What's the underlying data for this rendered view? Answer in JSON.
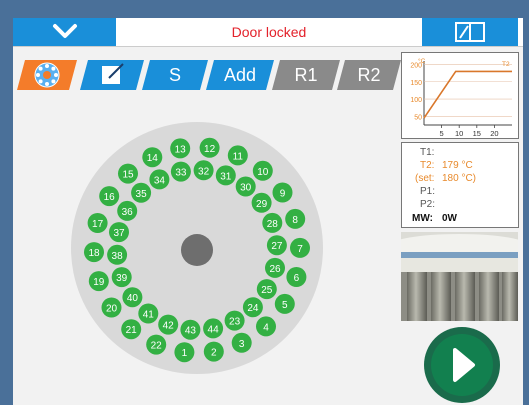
{
  "header": {
    "door_status": "Door locked"
  },
  "tabs": [
    {
      "label": "",
      "icon": "carousel-icon",
      "active": true
    },
    {
      "label": "",
      "icon": "edit-icon",
      "active": false
    },
    {
      "label": "S",
      "active": false
    },
    {
      "label": "Add",
      "active": false
    },
    {
      "label": "R1",
      "active": false
    },
    {
      "label": "R2",
      "active": false
    }
  ],
  "carousel": {
    "positions": [
      "1",
      "2",
      "3",
      "4",
      "5",
      "6",
      "7",
      "8",
      "9",
      "10",
      "11",
      "12",
      "13",
      "14",
      "15",
      "16",
      "17",
      "18",
      "19",
      "20",
      "21",
      "22",
      "23",
      "24",
      "25",
      "26",
      "27",
      "28",
      "29",
      "30",
      "31",
      "32",
      "33",
      "34",
      "35",
      "36",
      "37",
      "38",
      "39",
      "40",
      "41",
      "42",
      "43",
      "44"
    ]
  },
  "readings": {
    "t1_label": "T1:",
    "t1_value": "",
    "t2_label": "T2:",
    "t2_value": "179 °C",
    "set_label": "(set:",
    "set_value": "180 °C)",
    "p1_label": "P1:",
    "p1_value": "",
    "p2_label": "P2:",
    "p2_value": "",
    "mw_label": "MW:",
    "mw_value": "0W"
  },
  "chart_data": {
    "type": "line",
    "ylabel": "°C",
    "series_label": "T2",
    "x_ticks": [
      "5",
      "10",
      "15",
      "20"
    ],
    "y_ticks": [
      "200",
      "150",
      "100",
      "50"
    ],
    "xlim": [
      0,
      25
    ],
    "ylim": [
      25,
      210
    ],
    "series": [
      {
        "name": "T2",
        "x": [
          0,
          9,
          25
        ],
        "y": [
          45,
          180,
          180
        ]
      }
    ],
    "colors": {
      "line": "#d9772b",
      "grid": "#e6c0a8"
    }
  },
  "colors": {
    "accent": "#1a8fd9",
    "tab_active": "#f47c2a",
    "tab_inactive": "#8a8a8a",
    "position": "#33b043"
  }
}
